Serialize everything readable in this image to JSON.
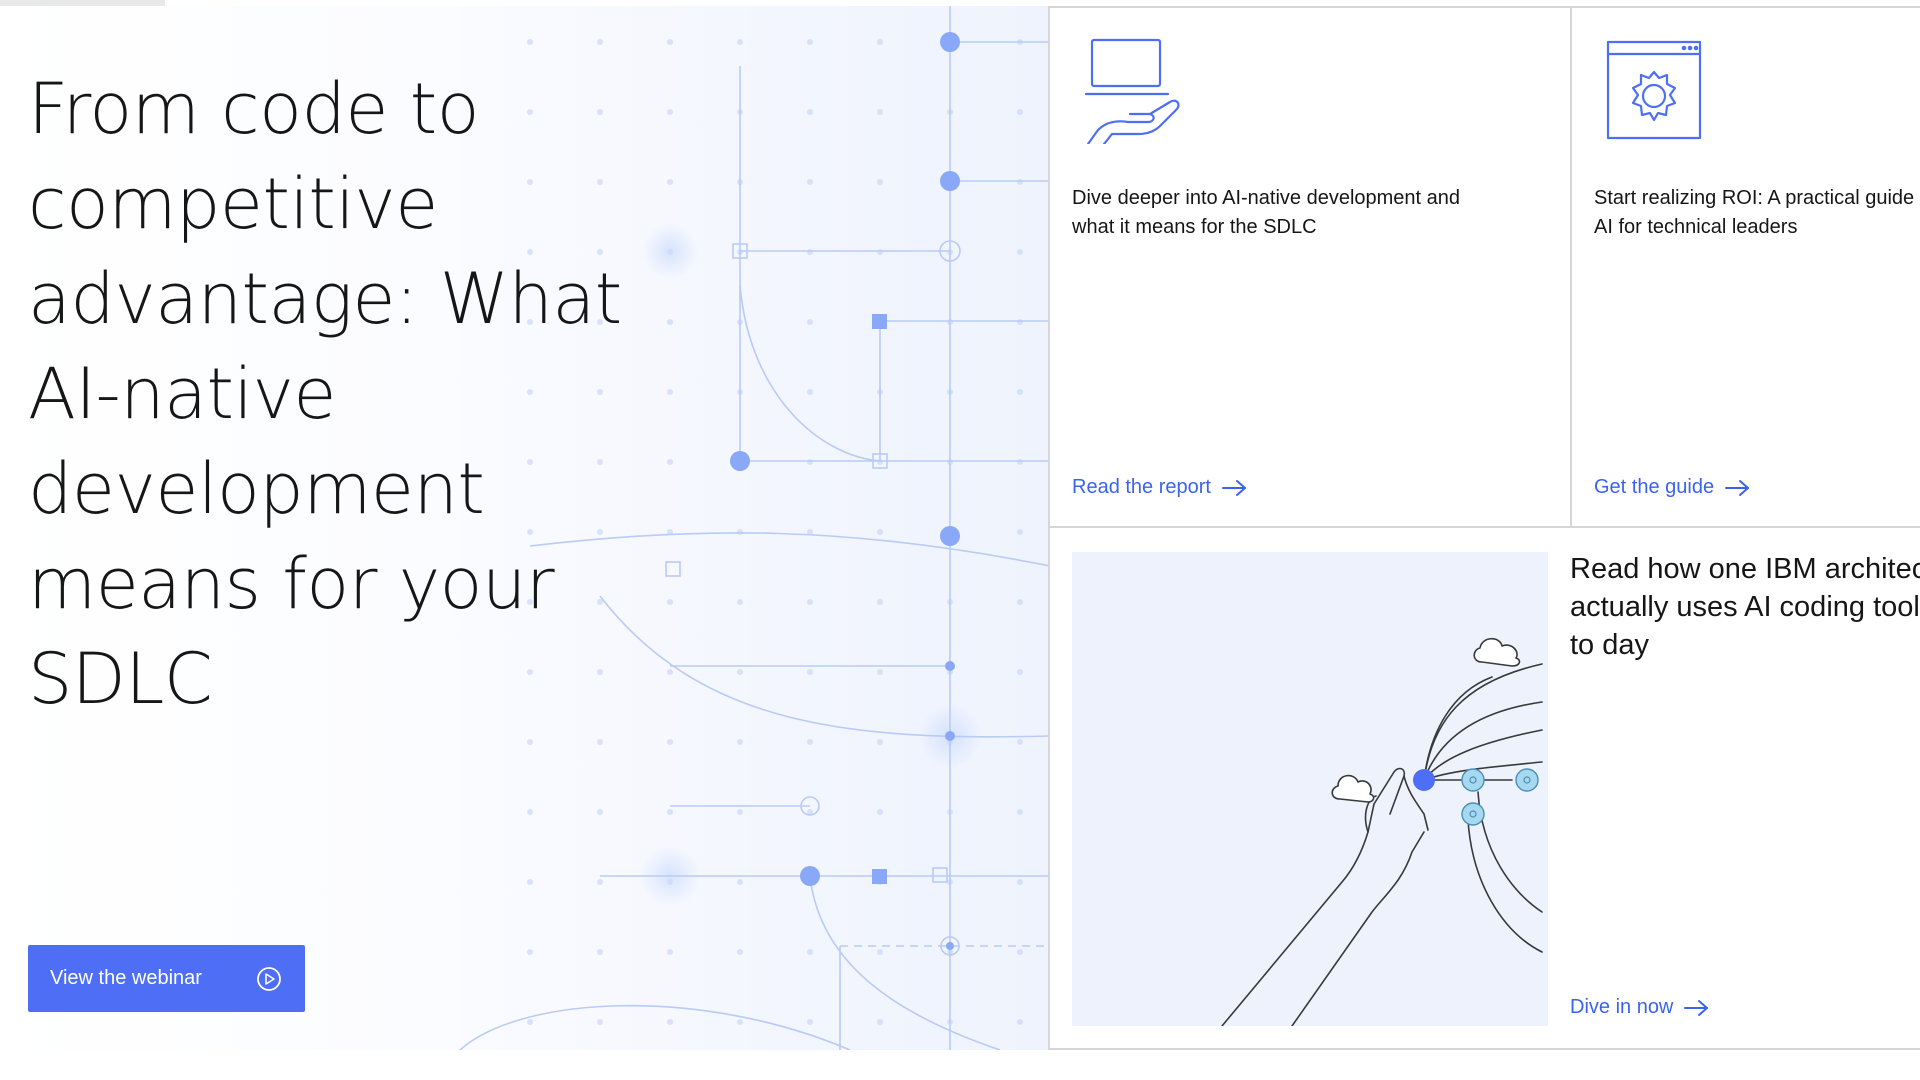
{
  "hero": {
    "title": "From code to competitive advantage: What AI-native development means for your SDLC",
    "cta_label": "View the webinar"
  },
  "cards": [
    {
      "icon": "hand-laptop-icon",
      "text_line1": "Dive deeper into AI-native development and",
      "text_line2": "what it means for the SDLC",
      "link": "Read the report"
    },
    {
      "icon": "gear-window-icon",
      "text_line1": "Start realizing ROI: A practical guide to",
      "text_line2": "AI for technical leaders",
      "link": "Get the guide"
    }
  ],
  "feature": {
    "heading_line1": "Read how one IBM architect",
    "heading_line2": "actually uses AI coding tools",
    "heading_line3": "to day",
    "link": "Dive in now",
    "illustration": "hand-network-illustration"
  },
  "colors": {
    "accent": "#4e6ff5",
    "link": "#3b63ef",
    "text": "#161616",
    "border": "#d6d6d6"
  }
}
